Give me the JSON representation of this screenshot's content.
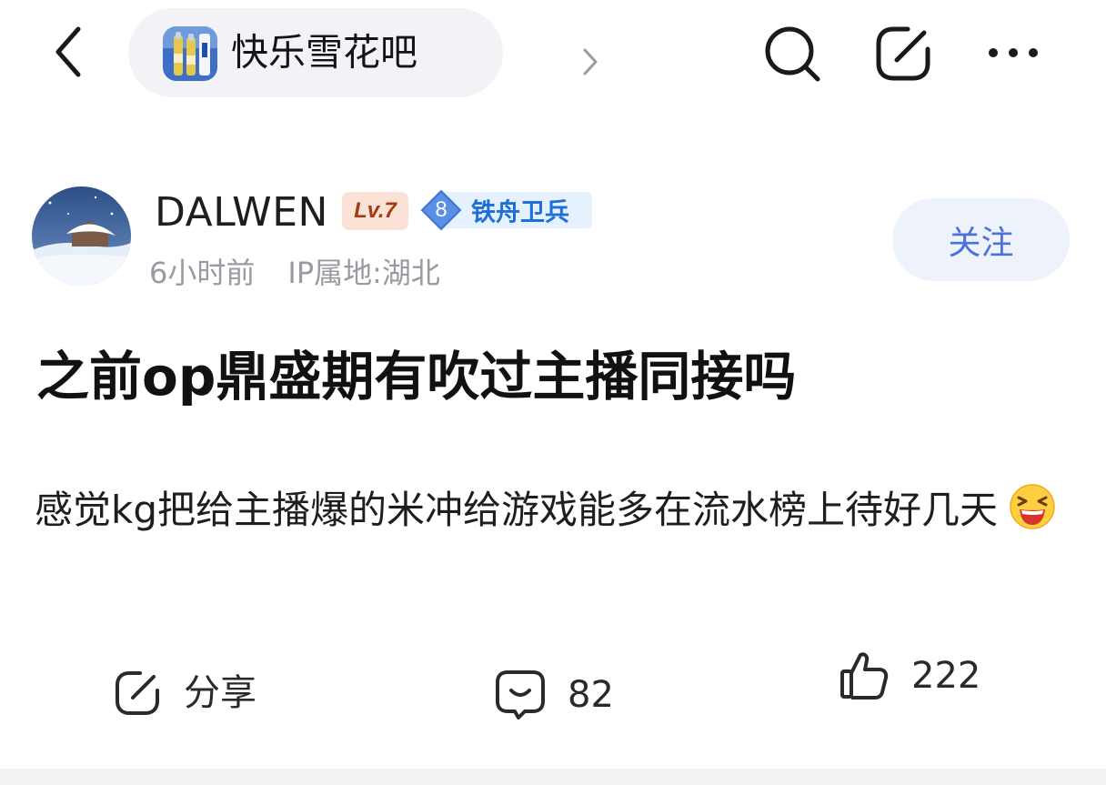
{
  "forum": {
    "name": "快乐雪花吧"
  },
  "author": {
    "name": "DALWEN",
    "level": "Lv.7",
    "rank_number": "8",
    "rank_title": "铁舟卫兵",
    "time_ago": "6小时前",
    "ip_location": "IP属地:湖北",
    "follow_label": "关注"
  },
  "post": {
    "title": "之前op鼎盛期有吹过主播同接吗",
    "body": "感觉kg把给主播爆的米冲给游戏能多在流水榜上待好几天",
    "emoji": "laughing-emoji"
  },
  "actions": {
    "share_label": "分享",
    "comment_count": "82",
    "like_count": "222"
  },
  "icons": {
    "back": "chevron-left-icon",
    "search": "search-icon",
    "edit": "edit-icon",
    "more": "more-dots-icon"
  },
  "colors": {
    "follow_text": "#4c71d8",
    "follow_bg": "#eef2fb",
    "level_text": "#a63a12",
    "level_bg": "#fbe1d6",
    "rank_blue": "#1e6fd8",
    "meta_gray": "#9a9aa2"
  }
}
